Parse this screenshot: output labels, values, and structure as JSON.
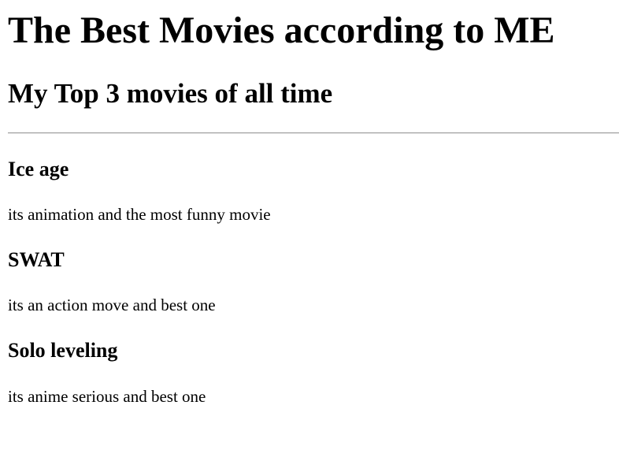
{
  "page": {
    "title": "The Best Movies according to ME",
    "subtitle": "My Top 3 movies of all time"
  },
  "movies": [
    {
      "title": "Ice age",
      "description": "its animation and the most funny movie"
    },
    {
      "title": "SWAT",
      "description": "its an action move and best one"
    },
    {
      "title": "Solo leveling",
      "description": "its anime serious and best one"
    }
  ]
}
